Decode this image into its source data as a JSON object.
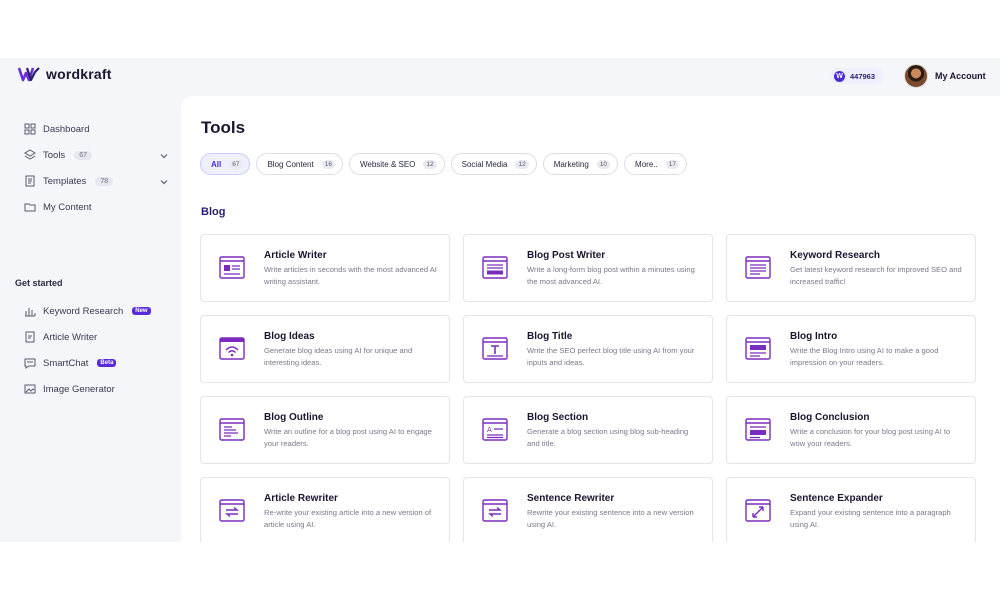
{
  "brand": {
    "name": "wordkraft"
  },
  "header": {
    "credits": "447963",
    "account_label": "My Account"
  },
  "sidebar": {
    "items": [
      {
        "label": "Dashboard",
        "icon": "grid-icon"
      },
      {
        "label": "Tools",
        "count": "67",
        "icon": "layers-icon"
      },
      {
        "label": "Templates",
        "count": "78",
        "icon": "document-icon"
      },
      {
        "label": "My Content",
        "icon": "folder-icon"
      }
    ],
    "section_title": "Get started",
    "get_started": [
      {
        "label": "Keyword Research",
        "badge": "New",
        "icon": "bar-chart-icon"
      },
      {
        "label": "Article Writer",
        "icon": "edit-document-icon"
      },
      {
        "label": "SmartChat",
        "badge": "Beta",
        "icon": "chat-icon"
      },
      {
        "label": "Image Generator",
        "icon": "image-icon"
      }
    ]
  },
  "main": {
    "title": "Tools",
    "filters": [
      {
        "label": "All",
        "count": "67",
        "active": true
      },
      {
        "label": "Blog Content",
        "count": "16"
      },
      {
        "label": "Website & SEO",
        "count": "12"
      },
      {
        "label": "Social Media",
        "count": "12"
      },
      {
        "label": "Marketing",
        "count": "10"
      },
      {
        "label": "More..",
        "count": "17"
      }
    ],
    "group_title": "Blog",
    "tools": [
      {
        "title": "Article Writer",
        "desc": "Write articles in seconds with the most advanced AI writing assistant.",
        "icon": "article-icon"
      },
      {
        "title": "Blog Post Writer",
        "desc": "Write a long-form blog post within a minutes using the most advanced AI.",
        "icon": "blog-post-icon"
      },
      {
        "title": "Keyword Research",
        "desc": "Get latest keyword research for improved SEO and increased traffic!",
        "icon": "keyword-icon"
      },
      {
        "title": "Blog Ideas",
        "desc": "Generate blog ideas using AI for unique and interesting ideas.",
        "icon": "idea-wifi-icon"
      },
      {
        "title": "Blog Title",
        "desc": "Write the SEO perfect blog title using AI from your inputs and ideas.",
        "icon": "title-icon"
      },
      {
        "title": "Blog Intro",
        "desc": "Write the Blog Intro using AI to make a good impression on your readers.",
        "icon": "intro-icon"
      },
      {
        "title": "Blog Outline",
        "desc": "Write an outline for a blog post using AI to engage your readers.",
        "icon": "outline-icon"
      },
      {
        "title": "Blog Section",
        "desc": "Generate a blog section using blog sub-heading and title.",
        "icon": "section-icon"
      },
      {
        "title": "Blog Conclusion",
        "desc": "Write a conclusion for your blog post using AI to wow your readers.",
        "icon": "conclusion-icon"
      },
      {
        "title": "Article Rewriter",
        "desc": "Re-write your existing article into a new version of article using AI.",
        "icon": "rewrite-icon"
      },
      {
        "title": "Sentence Rewriter",
        "desc": "Rewrite your existing sentence into a new version using AI.",
        "icon": "sentence-rewrite-icon"
      },
      {
        "title": "Sentence Expander",
        "desc": "Expand your existing sentence into a paragraph using AI.",
        "icon": "expand-icon"
      }
    ]
  },
  "colors": {
    "accent": "#5a2bd8",
    "icon_purple": "#7b2cbf",
    "background": "#f5f6fa"
  }
}
